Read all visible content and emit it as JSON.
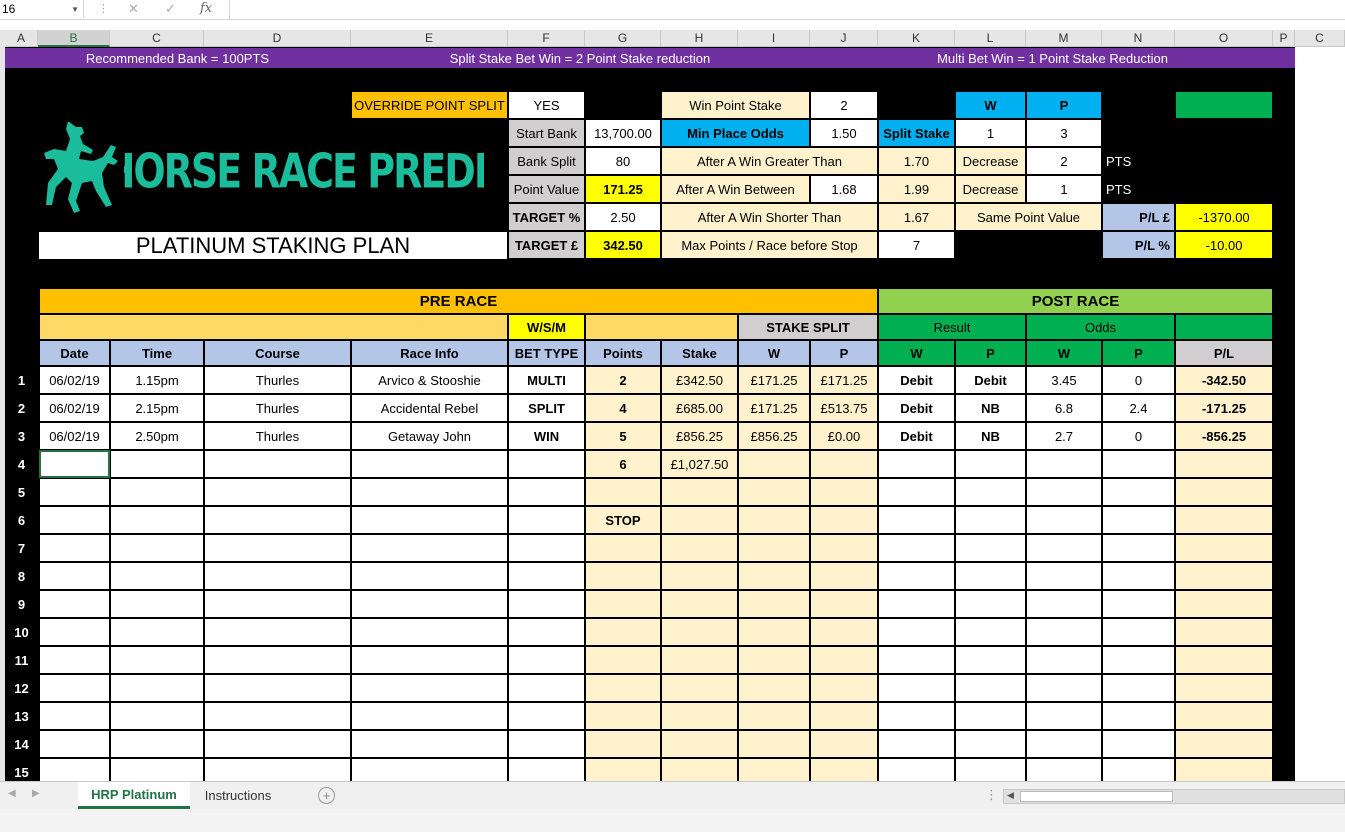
{
  "formula_bar": {
    "name_box": "16",
    "cancel_icon": "✕",
    "enter_icon": "✓",
    "fx_label": "fx"
  },
  "columns": [
    "A",
    "B",
    "C",
    "D",
    "E",
    "F",
    "G",
    "H",
    "I",
    "J",
    "K",
    "L",
    "M",
    "N",
    "O",
    "P",
    "C"
  ],
  "banner": {
    "left": "Recommended Bank = 100PTS",
    "middle": "Split Stake Bet Win = 2 Point Stake reduction",
    "right": "Multi Bet Win = 1 Point  Stake Reduction"
  },
  "logo": {
    "title": "THE HORSE RACE PREDICTOR",
    "plan": "PLATINUM STAKING PLAN"
  },
  "settings": {
    "override_label": "OVERRIDE POINT SPLIT",
    "override_value": "YES",
    "start_bank_label": "Start Bank",
    "start_bank_value": "13,700.00",
    "bank_split_label": "Bank Split",
    "bank_split_value": "80",
    "point_value_label": "Point Value",
    "point_value_value": "171.25",
    "target_pct_label": "TARGET %",
    "target_pct_value": "2.50",
    "target_gbp_label": "TARGET £",
    "target_gbp_value": "342.50",
    "win_point_stake_label": "Win Point Stake",
    "win_point_stake_value": "2",
    "min_place_odds_label": "Min Place Odds",
    "min_place_odds_value": "1.50",
    "after_win_greater_label": "After A Win Greater Than",
    "after_win_greater_value": "1.70",
    "after_win_between_label": "After A Win Between",
    "after_win_between_low": "1.68",
    "after_win_between_high": "1.99",
    "after_win_shorter_label": "After A Win Shorter Than",
    "after_win_shorter_value": "1.67",
    "max_points_label": "Max Points / Race before Stop",
    "max_points_value": "7",
    "w_header": "W",
    "p_header": "P",
    "split_stake_label": "Split Stake",
    "split_w": "1",
    "split_p": "3",
    "decrease_label_1": "Decrease",
    "decrease_value_1": "2",
    "pts_1": "PTS",
    "decrease_label_2": "Decrease",
    "decrease_value_2": "1",
    "pts_2": "PTS",
    "same_point_value_label": "Same Point Value",
    "pl_gbp_label": "P/L  £",
    "pl_gbp_value": "-1370.00",
    "pl_pct_label": "P/L %",
    "pl_pct_value": "-10.00"
  },
  "table": {
    "pre_race": "PRE RACE",
    "post_race": "POST RACE",
    "wsm": "W/S/M",
    "stake_split": "STAKE SPLIT",
    "result": "Result",
    "odds": "Odds",
    "headers": [
      "Date",
      "Time",
      "Course",
      "Race Info",
      "BET TYPE",
      "Points",
      "Stake",
      "W",
      "P",
      "W",
      "P",
      "W",
      "P",
      "P/L"
    ],
    "rows": [
      {
        "n": "1",
        "date": "06/02/19",
        "time": "1.15pm",
        "course": "Thurles",
        "info": "Arvico & Stooshie",
        "bet": "MULTI",
        "points": "2",
        "stake": "£342.50",
        "sw": "£171.25",
        "sp": "£171.25",
        "rw": "Debit",
        "rp": "Debit",
        "ow": "3.45",
        "op": "0",
        "pl": "-342.50"
      },
      {
        "n": "2",
        "date": "06/02/19",
        "time": "2.15pm",
        "course": "Thurles",
        "info": "Accidental Rebel",
        "bet": "SPLIT",
        "points": "4",
        "stake": "£685.00",
        "sw": "£171.25",
        "sp": "£513.75",
        "rw": "Debit",
        "rp": "NB",
        "ow": "6.8",
        "op": "2.4",
        "pl": "-171.25"
      },
      {
        "n": "3",
        "date": "06/02/19",
        "time": "2.50pm",
        "course": "Thurles",
        "info": "Getaway John",
        "bet": "WIN",
        "points": "5",
        "stake": "£856.25",
        "sw": "£856.25",
        "sp": "£0.00",
        "rw": "Debit",
        "rp": "NB",
        "ow": "2.7",
        "op": "0",
        "pl": "-856.25"
      },
      {
        "n": "4",
        "date": "",
        "time": "",
        "course": "",
        "info": "",
        "bet": "",
        "points": "6",
        "stake": "£1,027.50",
        "sw": "",
        "sp": "",
        "rw": "",
        "rp": "",
        "ow": "",
        "op": "",
        "pl": ""
      },
      {
        "n": "5",
        "date": "",
        "time": "",
        "course": "",
        "info": "",
        "bet": "",
        "points": "",
        "stake": "",
        "sw": "",
        "sp": "",
        "rw": "",
        "rp": "",
        "ow": "",
        "op": "",
        "pl": ""
      },
      {
        "n": "6",
        "date": "",
        "time": "",
        "course": "",
        "info": "",
        "bet": "",
        "points": "STOP",
        "stake": "",
        "sw": "",
        "sp": "",
        "rw": "",
        "rp": "",
        "ow": "",
        "op": "",
        "pl": ""
      },
      {
        "n": "7",
        "date": "",
        "time": "",
        "course": "",
        "info": "",
        "bet": "",
        "points": "",
        "stake": "",
        "sw": "",
        "sp": "",
        "rw": "",
        "rp": "",
        "ow": "",
        "op": "",
        "pl": ""
      },
      {
        "n": "8",
        "date": "",
        "time": "",
        "course": "",
        "info": "",
        "bet": "",
        "points": "",
        "stake": "",
        "sw": "",
        "sp": "",
        "rw": "",
        "rp": "",
        "ow": "",
        "op": "",
        "pl": ""
      },
      {
        "n": "9",
        "date": "",
        "time": "",
        "course": "",
        "info": "",
        "bet": "",
        "points": "",
        "stake": "",
        "sw": "",
        "sp": "",
        "rw": "",
        "rp": "",
        "ow": "",
        "op": "",
        "pl": ""
      },
      {
        "n": "10",
        "date": "",
        "time": "",
        "course": "",
        "info": "",
        "bet": "",
        "points": "",
        "stake": "",
        "sw": "",
        "sp": "",
        "rw": "",
        "rp": "",
        "ow": "",
        "op": "",
        "pl": ""
      },
      {
        "n": "11",
        "date": "",
        "time": "",
        "course": "",
        "info": "",
        "bet": "",
        "points": "",
        "stake": "",
        "sw": "",
        "sp": "",
        "rw": "",
        "rp": "",
        "ow": "",
        "op": "",
        "pl": ""
      },
      {
        "n": "12",
        "date": "",
        "time": "",
        "course": "",
        "info": "",
        "bet": "",
        "points": "",
        "stake": "",
        "sw": "",
        "sp": "",
        "rw": "",
        "rp": "",
        "ow": "",
        "op": "",
        "pl": ""
      },
      {
        "n": "13",
        "date": "",
        "time": "",
        "course": "",
        "info": "",
        "bet": "",
        "points": "",
        "stake": "",
        "sw": "",
        "sp": "",
        "rw": "",
        "rp": "",
        "ow": "",
        "op": "",
        "pl": ""
      },
      {
        "n": "14",
        "date": "",
        "time": "",
        "course": "",
        "info": "",
        "bet": "",
        "points": "",
        "stake": "",
        "sw": "",
        "sp": "",
        "rw": "",
        "rp": "",
        "ow": "",
        "op": "",
        "pl": ""
      },
      {
        "n": "15",
        "date": "",
        "time": "",
        "course": "",
        "info": "",
        "bet": "",
        "points": "",
        "stake": "",
        "sw": "",
        "sp": "",
        "rw": "",
        "rp": "",
        "ow": "",
        "op": "",
        "pl": ""
      }
    ]
  },
  "tabs": {
    "active": "HRP Platinum",
    "other": "Instructions",
    "add": "+"
  },
  "colors": {
    "purple": "#7030a0",
    "orange": "#ffc000",
    "light_orange": "#ffd966",
    "cream": "#fff2cc",
    "blue": "#b4c6e7",
    "cyan": "#00b0f0",
    "green": "#92d050",
    "dark_green": "#00b050",
    "teal": "#1abc9c",
    "yellow": "#ffff00",
    "gray": "#d0cece"
  }
}
